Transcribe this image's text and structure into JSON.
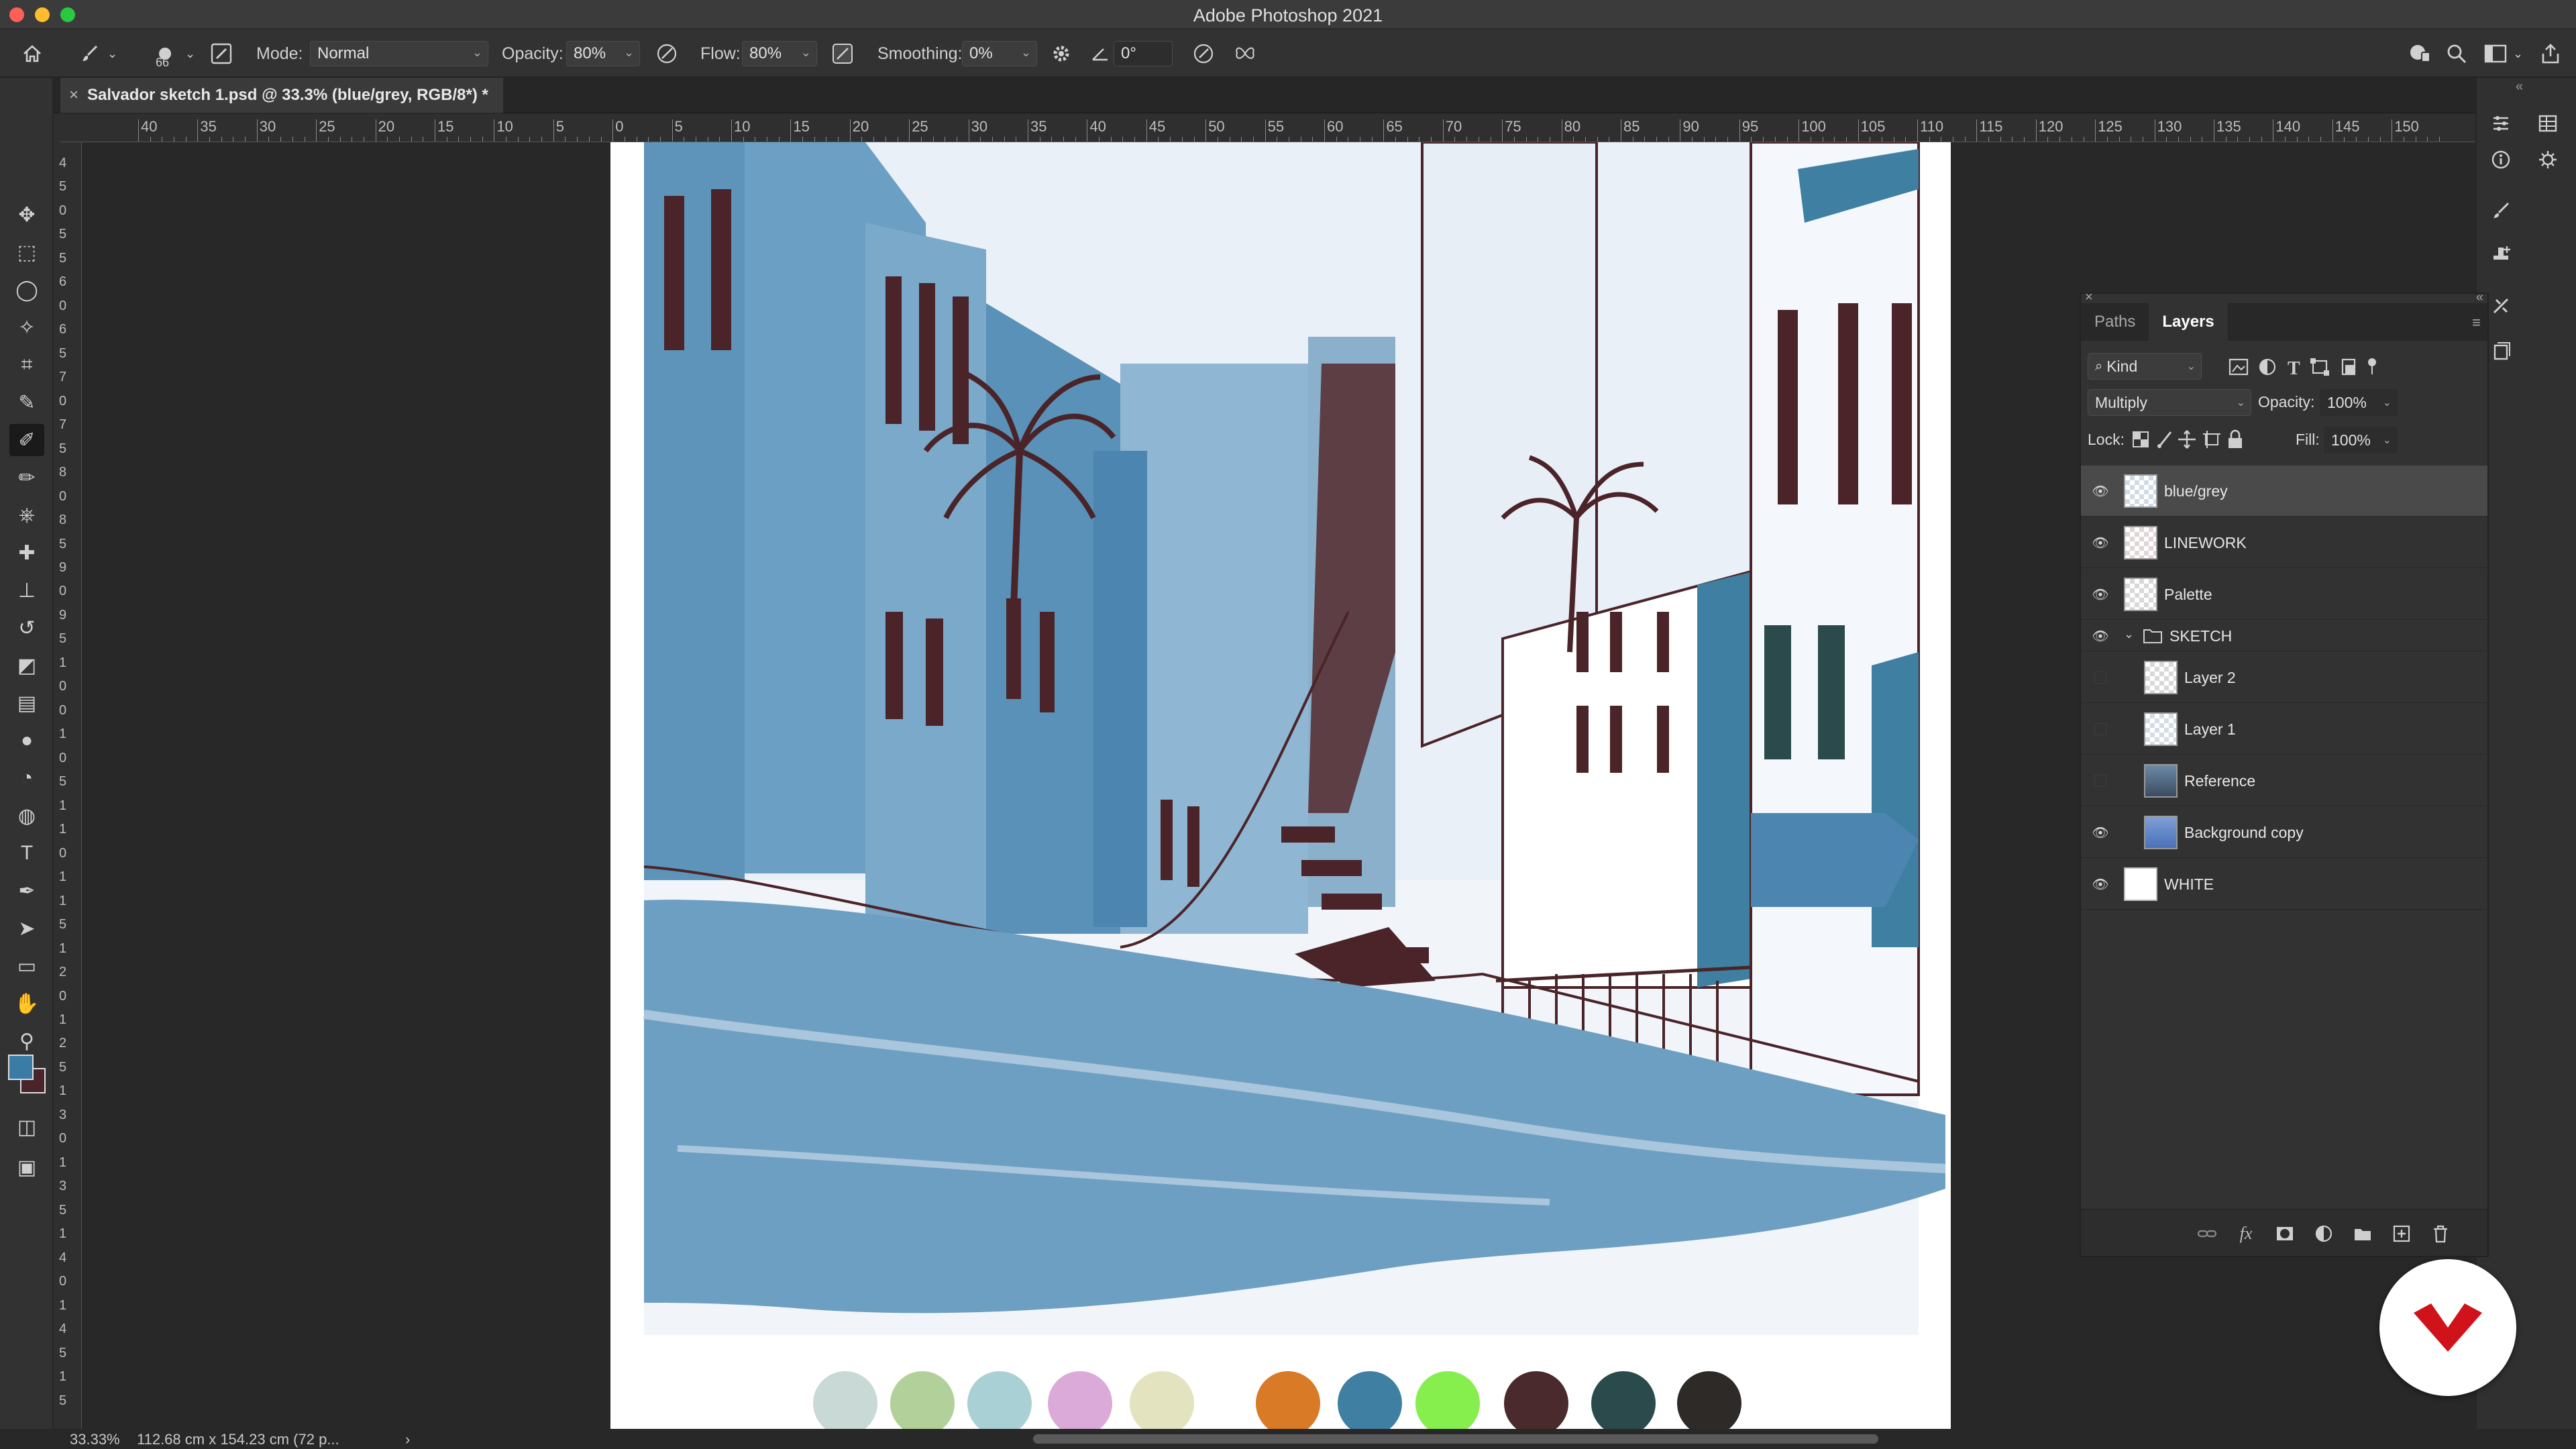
{
  "window": {
    "title": "Adobe Photoshop 2021"
  },
  "options_bar": {
    "brush_size": "66",
    "mode_label": "Mode:",
    "mode_value": "Normal",
    "opacity_label": "Opacity:",
    "opacity_value": "80%",
    "flow_label": "Flow:",
    "flow_value": "80%",
    "smoothing_label": "Smoothing:",
    "smoothing_value": "0%",
    "angle_value": "0°",
    "icons": [
      "home-icon",
      "brush-tool-icon",
      "brush-preset-icon",
      "brush-settings-icon",
      "pressure-opacity-icon",
      "airbrush-icon",
      "gear-icon",
      "angle-icon",
      "pressure-size-icon",
      "butterfly-icon",
      "learn-icon",
      "search-icon",
      "workspace-icon",
      "share-icon"
    ]
  },
  "document_tab": {
    "title": "Salvador sketch 1.psd @ 33.3% (blue/grey, RGB/8*) *",
    "close": "×"
  },
  "ruler": {
    "horizontal": [
      "40",
      "35",
      "30",
      "25",
      "20",
      "15",
      "10",
      "5",
      "0",
      "5",
      "10",
      "15",
      "20",
      "25",
      "30",
      "35",
      "40",
      "45",
      "50",
      "55",
      "60",
      "65",
      "70",
      "75",
      "80",
      "85",
      "90",
      "95",
      "100",
      "105",
      "110",
      "115",
      "120",
      "125",
      "130",
      "135",
      "140",
      "145",
      "150"
    ],
    "vertical": [
      "4",
      "5",
      "0",
      "5",
      "5",
      "6",
      "0",
      "6",
      "5",
      "7",
      "0",
      "7",
      "5",
      "8",
      "0",
      "8",
      "5",
      "9",
      "0",
      "9",
      "5",
      "1",
      "0",
      "0",
      "1",
      "0",
      "5",
      "1",
      "1",
      "0",
      "1",
      "1",
      "5",
      "1",
      "2",
      "0",
      "1",
      "2",
      "5",
      "1",
      "3",
      "0",
      "1",
      "3",
      "5",
      "1",
      "4",
      "0",
      "1",
      "4",
      "5",
      "1",
      "5"
    ]
  },
  "toolbar": {
    "tools": [
      "move-tool-icon",
      "marquee-tool-icon",
      "lasso-tool-icon",
      "magic-wand-tool-icon",
      "crop-tool-icon",
      "eyedropper-tool-icon",
      "brush-tool-icon",
      "pencil-tool-icon",
      "clone-stamp-icon",
      "healing-brush-icon",
      "stamp-tool-icon",
      "history-brush-icon",
      "eraser-tool-icon",
      "gradient-tool-icon",
      "blur-tool-icon",
      "dodge-tool-icon",
      "sponge-tool-icon",
      "type-tool-icon",
      "pen-tool-icon",
      "path-selection-icon",
      "rectangle-tool-icon",
      "hand-tool-icon",
      "zoom-tool-icon",
      "more-tools-icon"
    ],
    "foreground_color": "#3a7ca5",
    "background_color": "#4a2428"
  },
  "palette_swatches": [
    "#c8d9d6",
    "#b2d09a",
    "#a9d0d4",
    "#dcaad8",
    "#e3e3bf",
    "#d97a26",
    "#3f7fa2",
    "#86ef4e",
    "#4a2a2c",
    "#2a4a4c",
    "#2e2a28"
  ],
  "layers_panel": {
    "tabs": [
      "Paths",
      "Layers"
    ],
    "active_tab": "Layers",
    "filter_kind": "Kind",
    "blend_mode": "Multiply",
    "opacity_label": "Opacity:",
    "opacity_value": "100%",
    "lock_label": "Lock:",
    "fill_label": "Fill:",
    "fill_value": "100%",
    "layers": [
      {
        "name": "blue/grey",
        "visible": true,
        "selected": true,
        "indent": 0,
        "type": "layer"
      },
      {
        "name": "LINEWORK",
        "visible": true,
        "selected": false,
        "indent": 0,
        "type": "layer"
      },
      {
        "name": "Palette",
        "visible": true,
        "selected": false,
        "indent": 0,
        "type": "layer"
      },
      {
        "name": "SKETCH",
        "visible": true,
        "selected": false,
        "indent": 0,
        "type": "group"
      },
      {
        "name": "Layer 2",
        "visible": false,
        "selected": false,
        "indent": 1,
        "type": "layer"
      },
      {
        "name": "Layer 1",
        "visible": false,
        "selected": false,
        "indent": 1,
        "type": "layer"
      },
      {
        "name": "Reference",
        "visible": false,
        "selected": false,
        "indent": 1,
        "type": "layer"
      },
      {
        "name": "Background copy",
        "visible": true,
        "selected": false,
        "indent": 1,
        "type": "layer"
      },
      {
        "name": "WHITE",
        "visible": true,
        "selected": false,
        "indent": 0,
        "type": "layer"
      }
    ]
  },
  "status_bar": {
    "zoom": "33.33%",
    "doc_info": "112.68 cm x 154.23 cm (72 p...",
    "more": "›"
  },
  "colors": {
    "accent_blue": "#3a7ca5",
    "linework": "#4a2428",
    "brand_red": "#d0121a"
  }
}
